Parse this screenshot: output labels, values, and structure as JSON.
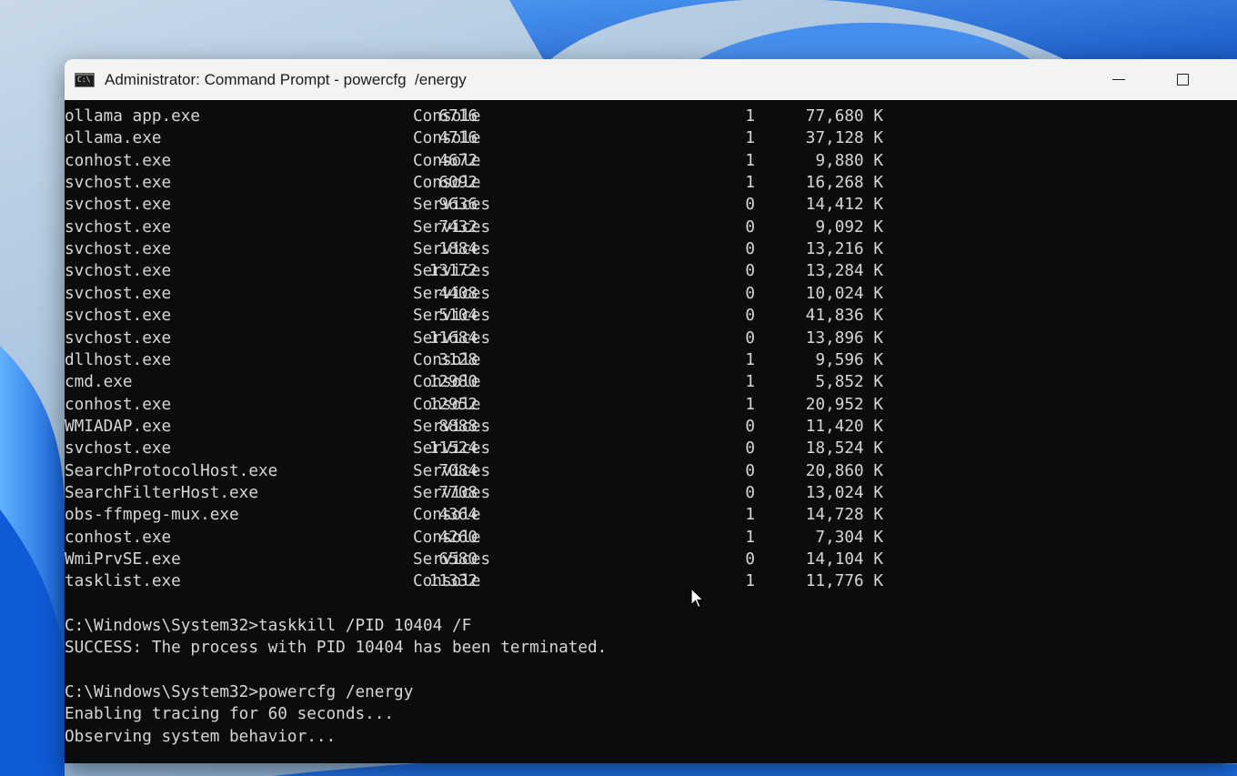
{
  "window": {
    "title": "Administrator: Command Prompt - powercfg  /energy",
    "icon": "cmd-icon",
    "controls": [
      "minimize-icon",
      "maximize-icon"
    ]
  },
  "tasklist_rows": [
    {
      "name": "ollama app.exe",
      "pid": "6716",
      "session": "Console",
      "session_num": "1",
      "mem": "77,680 K"
    },
    {
      "name": "ollama.exe",
      "pid": "4716",
      "session": "Console",
      "session_num": "1",
      "mem": "37,128 K"
    },
    {
      "name": "conhost.exe",
      "pid": "4672",
      "session": "Console",
      "session_num": "1",
      "mem": "9,880 K"
    },
    {
      "name": "svchost.exe",
      "pid": "6092",
      "session": "Console",
      "session_num": "1",
      "mem": "16,268 K"
    },
    {
      "name": "svchost.exe",
      "pid": "9636",
      "session": "Services",
      "session_num": "0",
      "mem": "14,412 K"
    },
    {
      "name": "svchost.exe",
      "pid": "7432",
      "session": "Services",
      "session_num": "0",
      "mem": "9,092 K"
    },
    {
      "name": "svchost.exe",
      "pid": "1884",
      "session": "Services",
      "session_num": "0",
      "mem": "13,216 K"
    },
    {
      "name": "svchost.exe",
      "pid": "13172",
      "session": "Services",
      "session_num": "0",
      "mem": "13,284 K"
    },
    {
      "name": "svchost.exe",
      "pid": "4408",
      "session": "Services",
      "session_num": "0",
      "mem": "10,024 K"
    },
    {
      "name": "svchost.exe",
      "pid": "5104",
      "session": "Services",
      "session_num": "0",
      "mem": "41,836 K"
    },
    {
      "name": "svchost.exe",
      "pid": "11684",
      "session": "Services",
      "session_num": "0",
      "mem": "13,896 K"
    },
    {
      "name": "dllhost.exe",
      "pid": "3128",
      "session": "Console",
      "session_num": "1",
      "mem": "9,596 K"
    },
    {
      "name": "cmd.exe",
      "pid": "12980",
      "session": "Console",
      "session_num": "1",
      "mem": "5,852 K"
    },
    {
      "name": "conhost.exe",
      "pid": "12952",
      "session": "Console",
      "session_num": "1",
      "mem": "20,952 K"
    },
    {
      "name": "WMIADAP.exe",
      "pid": "8888",
      "session": "Services",
      "session_num": "0",
      "mem": "11,420 K"
    },
    {
      "name": "svchost.exe",
      "pid": "11524",
      "session": "Services",
      "session_num": "0",
      "mem": "18,524 K"
    },
    {
      "name": "SearchProtocolHost.exe",
      "pid": "7084",
      "session": "Services",
      "session_num": "0",
      "mem": "20,860 K"
    },
    {
      "name": "SearchFilterHost.exe",
      "pid": "7708",
      "session": "Services",
      "session_num": "0",
      "mem": "13,024 K"
    },
    {
      "name": "obs-ffmpeg-mux.exe",
      "pid": "4364",
      "session": "Console",
      "session_num": "1",
      "mem": "14,728 K"
    },
    {
      "name": "conhost.exe",
      "pid": "4260",
      "session": "Console",
      "session_num": "1",
      "mem": "7,304 K"
    },
    {
      "name": "WmiPrvSE.exe",
      "pid": "6580",
      "session": "Services",
      "session_num": "0",
      "mem": "14,104 K"
    },
    {
      "name": "tasklist.exe",
      "pid": "11332",
      "session": "Console",
      "session_num": "1",
      "mem": "11,776 K"
    }
  ],
  "output_lines": [
    "C:\\Windows\\System32>taskkill /PID 10404 /F",
    "SUCCESS: The process with PID 10404 has been terminated.",
    "",
    "C:\\Windows\\System32>powercfg /energy",
    "Enabling tracing for 60 seconds...",
    "Observing system behavior..."
  ],
  "colors": {
    "console_bg": "#0c0c0c",
    "console_text": "#d6d6d6",
    "titlebar_bg": "#f3f3f3"
  }
}
